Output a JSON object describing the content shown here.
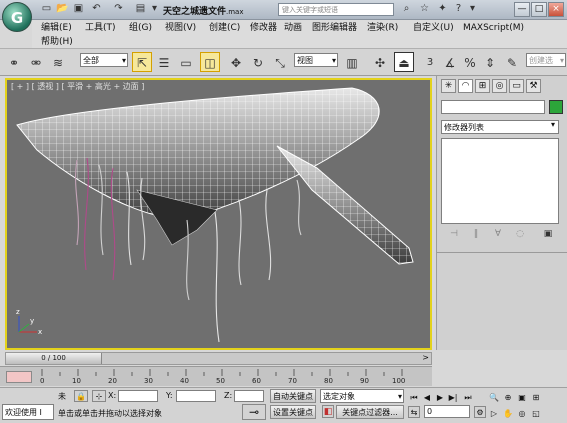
{
  "titlebar": {
    "filename": "天空之城遗文件",
    "extension": ".max",
    "search_placeholder": "键入关键字或短语",
    "help_btn": "?",
    "min_btn": "—",
    "max_btn": "□",
    "close_btn": "×"
  },
  "menu": [
    {
      "label": "编辑(E)"
    },
    {
      "label": "工具(T)"
    },
    {
      "label": "组(G)"
    },
    {
      "label": "视图(V)"
    },
    {
      "label": "创建(C)"
    },
    {
      "label": "修改器"
    },
    {
      "label": "动画"
    },
    {
      "label": "图形编辑器"
    },
    {
      "label": "渲染(R)"
    },
    {
      "label": "自定义(U)"
    },
    {
      "label": "MAXScript(M)"
    },
    {
      "label": "帮助(H)"
    }
  ],
  "toolbar": {
    "selection_filter": "全部",
    "ref_coord": "视图",
    "named_selection": "创建选"
  },
  "viewport": {
    "label": "[ + ] [ 透视 ] [ 平滑 + 高光 + 边面 ]",
    "axis_x": "x",
    "axis_y": "y",
    "axis_z": "z"
  },
  "command_panel": {
    "modifier_list": "修改器列表"
  },
  "timeslider": {
    "frame_display": "0 / 100"
  },
  "trackbar": {
    "ticks": [
      "0",
      "10",
      "20",
      "30",
      "40",
      "50",
      "60",
      "70",
      "80",
      "90",
      "100"
    ]
  },
  "status": {
    "welcome": "欢迎使用 I",
    "selection_status": "未",
    "prompt": "单击或单击并拖动以选择对象",
    "x_label": "X:",
    "y_label": "Y:",
    "z_label": "Z:",
    "auto_key": "自动关键点",
    "set_key": "设置关键点",
    "selected_object": "选定对象",
    "key_filter": "关键点过滤器...",
    "current_frame": "0"
  },
  "colors": {
    "viewport_border": "#e3d21b",
    "viewport_bg": "#6f6f6f",
    "object_color": "#2ca53a"
  }
}
